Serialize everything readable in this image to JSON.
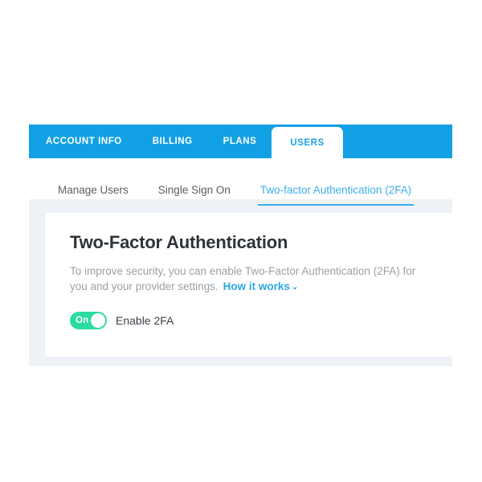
{
  "primary_tabs": [
    {
      "label": "ACCOUNT INFO",
      "active": false
    },
    {
      "label": "BILLING",
      "active": false
    },
    {
      "label": "PLANS",
      "active": false
    },
    {
      "label": "USERS",
      "active": true
    }
  ],
  "sub_tabs": [
    {
      "label": "Manage Users",
      "active": false
    },
    {
      "label": "Single Sign On",
      "active": false
    },
    {
      "label": "Two-factor Authentication (2FA)",
      "active": true
    }
  ],
  "content": {
    "title": "Two-Factor Authentication",
    "description": "To improve security, you can enable Two-Factor Authentication (2FA) for you and your provider settings.",
    "how_it_works_label": "How it works",
    "how_it_works_chevron": "⌄"
  },
  "toggle": {
    "state_label": "On",
    "field_label": "Enable 2FA",
    "enabled": true
  },
  "colors": {
    "brand_blue": "#11a0e4",
    "link_blue": "#2aa8e8",
    "toggle_green": "#2bdca0",
    "panel_gray": "#eef1f5",
    "heading": "#2d3338",
    "body_text": "#9ba0a8"
  }
}
